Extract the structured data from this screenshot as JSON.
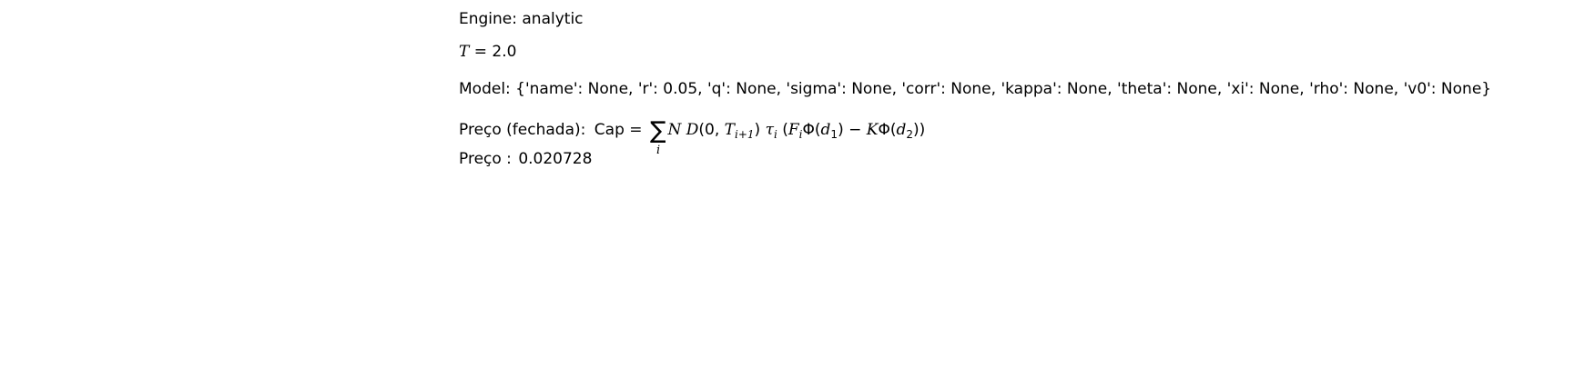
{
  "engine_line": "Engine: analytic",
  "maturity_line": {
    "symbol": "T",
    "equals": " = ",
    "value": "2.0"
  },
  "model_line": "Model: {'name': None, 'r': 0.05, 'q': None, 'sigma': None, 'corr': None, 'kappa': None, 'theta': None, 'xi': None, 'rho': None, 'v0': None}",
  "formula_line": {
    "label": "Preço (fechada):",
    "cap": "Cap",
    "equals": " = ",
    "sum_symbol": "∑",
    "sum_index": "i",
    "N": "N",
    "D": "D",
    "open_args": "(0, ",
    "T": "T",
    "T_sub": "i+1",
    "close_args": ")",
    "tau": "τ",
    "tau_sub": "i",
    "open_paren": " (",
    "F": "F",
    "F_sub": "i",
    "Phi1": "Φ(",
    "d1": "d",
    "d1_sub": "1",
    "close1": ")",
    "minus": " − ",
    "K": "K",
    "Phi2": "Φ(",
    "d2": "d",
    "d2_sub": "2",
    "close2": "))"
  },
  "price_line": {
    "label": "Preço :",
    "value": "0.020728"
  }
}
